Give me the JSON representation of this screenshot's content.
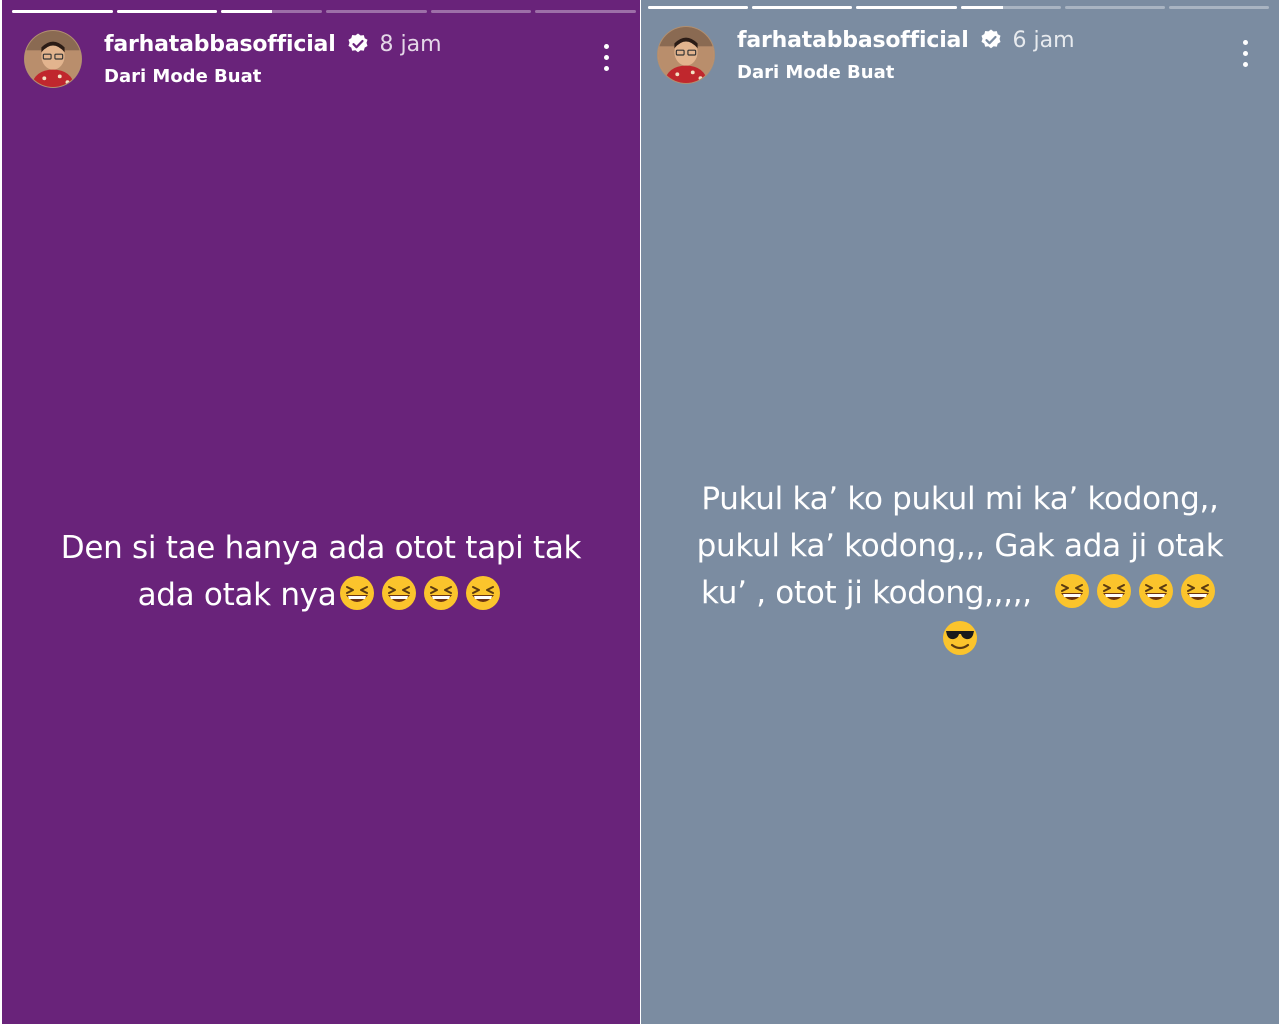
{
  "stories": [
    {
      "username": "farhatabbasofficial",
      "time": "8 jam",
      "subtitle": "Dari Mode Buat",
      "background": "#69237a",
      "progress": [
        1,
        1,
        0.5,
        0,
        0,
        0
      ],
      "caption_line1": "Den si tae hanya ada otot tapi tak",
      "caption_line2": "ada otak nya",
      "emojis_line2": [
        "grinning-squinting-face",
        "grinning-squinting-face",
        "grinning-squinting-face",
        "grinning-squinting-face"
      ]
    },
    {
      "username": "farhatabbasofficial",
      "time": "6 jam",
      "subtitle": "Dari Mode Buat",
      "background": "#7b8ca1",
      "progress": [
        1,
        1,
        1,
        0.42,
        0,
        0
      ],
      "caption_line1": "Pukul ka’  ko pukul mi ka’ kodong,,",
      "caption_line2": "pukul ka’ kodong,,, Gak ada ji otak",
      "caption_line3": "ku’ , otot ji kodong,,,,,",
      "emojis_line3": [
        "grinning-squinting-face",
        "grinning-squinting-face",
        "grinning-squinting-face",
        "grinning-squinting-face"
      ],
      "emojis_line4": [
        "smiling-face-with-sunglasses"
      ]
    }
  ],
  "colors": {
    "verified_badge": "#ffffff",
    "emoji_face": "#fbc42c",
    "text": "#ffffff"
  }
}
